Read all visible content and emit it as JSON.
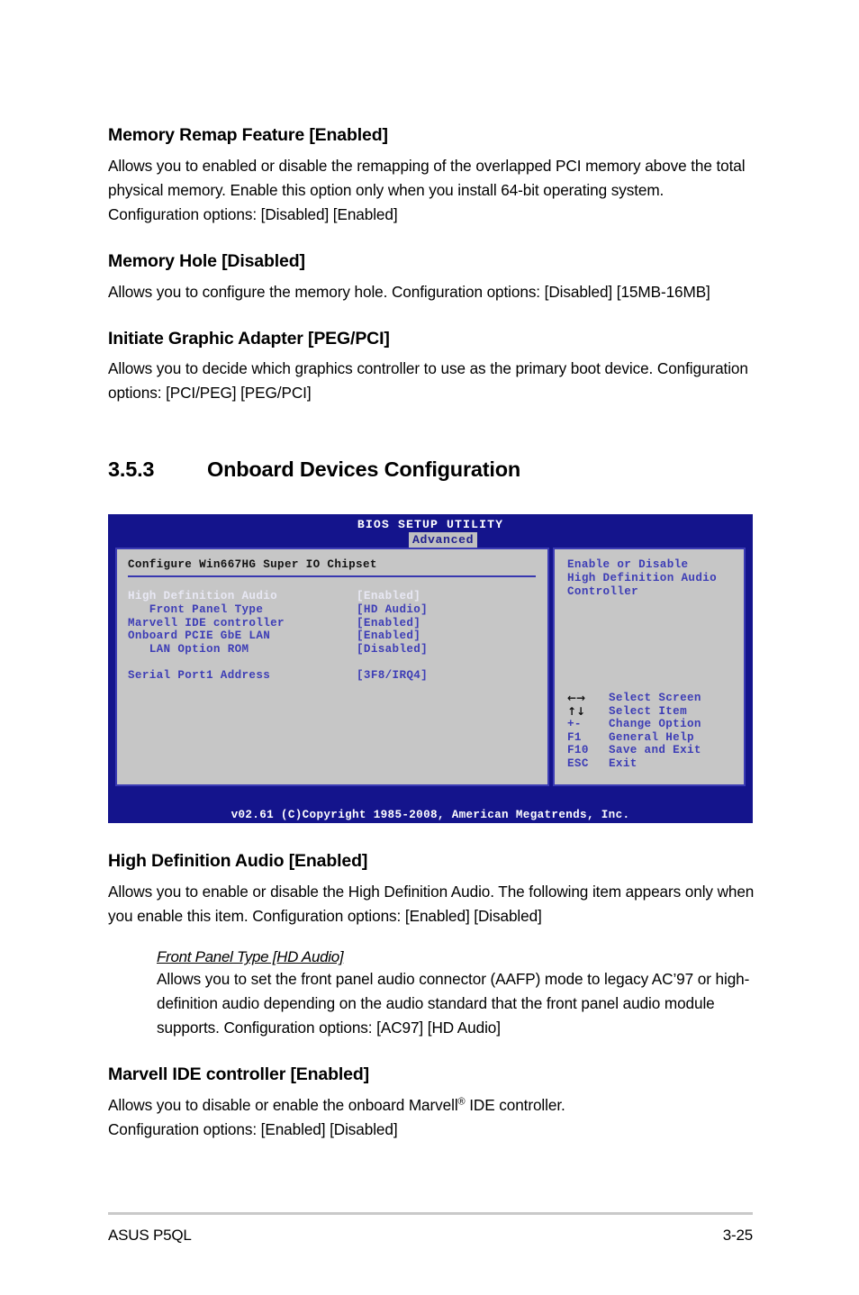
{
  "document": {
    "sections": [
      {
        "heading": "Memory Remap Feature [Enabled]",
        "body": "Allows you to enabled or disable the remapping of the overlapped PCI memory above the total physical memory. Enable this option only when you install 64-bit operating system. Configuration options: [Disabled] [Enabled]"
      },
      {
        "heading": "Memory Hole [Disabled]",
        "body": "Allows you to configure the memory hole. Configuration options: [Disabled] [15MB-16MB]"
      },
      {
        "heading": "Initiate Graphic Adapter [PEG/PCI]",
        "body": "Allows you to decide which graphics controller to use as the primary boot device. Configuration options: [PCI/PEG] [PEG/PCI]"
      }
    ],
    "section_number": "3.5.3",
    "section_title": "Onboard Devices Configuration",
    "sections_after": [
      {
        "heading": "High Definition Audio [Enabled]",
        "body": "Allows you to enable or disable the High Definition Audio. The following item appears only when you enable this item. Configuration options: [Enabled] [Disabled]"
      }
    ],
    "sub_block": {
      "lead": "Front Panel Type [HD Audio]",
      "body": "Allows you to set the front panel audio connector (AAFP) mode to legacy AC’97 or high-definition audio depending on the audio standard that the front panel audio module supports. Configuration options: [AC97] [HD Audio]"
    },
    "last_section": {
      "heading": "Marvell IDE controller [Enabled]",
      "body_line1": "Allows you to disable or enable the onboard Marvell",
      "body_sup": "®",
      "body_line1b": " IDE controller.",
      "body_line2": "Configuration options: [Enabled] [Disabled]"
    }
  },
  "bios": {
    "title": "BIOS SETUP UTILITY",
    "active_tab": "Advanced",
    "config_title": "Configure Win667HG Super IO Chipset",
    "options": [
      {
        "label": "High Definition Audio",
        "value": "[Enabled]",
        "selected": true,
        "indent": false,
        "spacer_after": false
      },
      {
        "label": "Front Panel Type",
        "value": "[HD Audio]",
        "selected": false,
        "indent": true,
        "spacer_after": false
      },
      {
        "label": "Marvell IDE controller",
        "value": "[Enabled]",
        "selected": false,
        "indent": false,
        "spacer_after": false
      },
      {
        "label": "Onboard PCIE GbE LAN",
        "value": "[Enabled]",
        "selected": false,
        "indent": false,
        "spacer_after": false
      },
      {
        "label": "LAN Option ROM",
        "value": "[Disabled]",
        "selected": false,
        "indent": true,
        "spacer_after": true
      },
      {
        "label": "Serial Port1 Address",
        "value": "[3F8/IRQ4]",
        "selected": false,
        "indent": false,
        "spacer_after": false
      }
    ],
    "help_text": "Enable or Disable\nHigh Definition Audio\nController",
    "keys": [
      {
        "key": "←→",
        "glyph": true,
        "action": "Select Screen",
        "icon": "left-right-arrow-icon"
      },
      {
        "key": "↑↓",
        "glyph": true,
        "action": "Select Item",
        "icon": "up-down-arrow-icon"
      },
      {
        "key": "+-",
        "glyph": false,
        "action": "Change Option",
        "icon": "plus-minus-icon"
      },
      {
        "key": "F1",
        "glyph": false,
        "action": "General Help",
        "icon": "f1-key-icon"
      },
      {
        "key": "F10",
        "glyph": false,
        "action": "Save and Exit",
        "icon": "f10-key-icon"
      },
      {
        "key": "ESC",
        "glyph": false,
        "action": "Exit",
        "icon": "esc-key-icon"
      }
    ],
    "footer": "v02.61 (C)Copyright 1985-2008, American Megatrends, Inc.",
    "colors": {
      "window_blue": "#14148c",
      "panel_gray": "#c6c6c6",
      "panel_border": "#3c3cb4",
      "text_blue": "#3d3db6",
      "selected_text": "#e8e8f4",
      "tab_bg": "#c0c0c0"
    }
  },
  "page_footer": {
    "left": "ASUS P5QL",
    "right": "3-25"
  }
}
